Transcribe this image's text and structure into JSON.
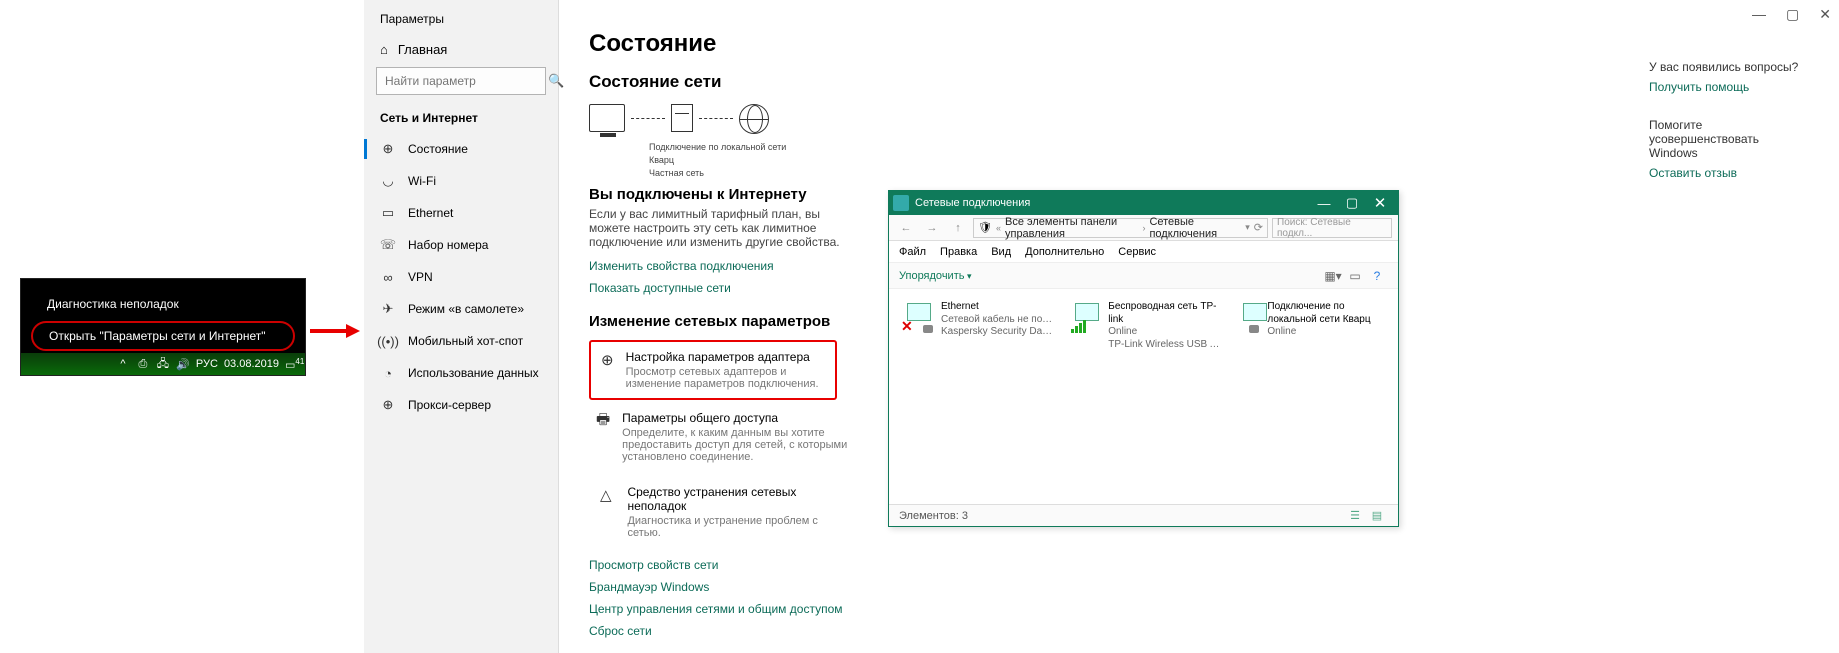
{
  "taskbar": {
    "item1": "Диагностика неполадок",
    "item2": "Открыть \"Параметры сети и Интернет\"",
    "lang": "РУС",
    "date": "03.08.2019",
    "badge": "41"
  },
  "settings": {
    "app_title": "Параметры",
    "home": "Главная",
    "search_placeholder": "Найти параметр",
    "section": "Сеть и Интернет",
    "nav": [
      {
        "label": "Состояние"
      },
      {
        "label": "Wi-Fi"
      },
      {
        "label": "Ethernet"
      },
      {
        "label": "Набор номера"
      },
      {
        "label": "VPN"
      },
      {
        "label": "Режим «в самолете»"
      },
      {
        "label": "Мобильный хот-спот"
      },
      {
        "label": "Использование данных"
      },
      {
        "label": "Прокси-сервер"
      }
    ],
    "page_title": "Состояние",
    "status_title": "Состояние сети",
    "diagram": {
      "line1": "Подключение по локальной сети",
      "line2": "Кварц",
      "line3": "Частная сеть"
    },
    "connected_title": "Вы подключены к Интернету",
    "connected_body": "Если у вас лимитный тарифный план, вы можете настроить эту сеть как лимитное подключение или изменить другие свойства.",
    "link_props": "Изменить свойства подключения",
    "link_show": "Показать доступные сети",
    "change_title": "Изменение сетевых параметров",
    "opts": [
      {
        "title": "Настройка параметров адаптера",
        "desc": "Просмотр сетевых адаптеров и изменение параметров подключения."
      },
      {
        "title": "Параметры общего доступа",
        "desc": "Определите, к каким данным вы хотите предоставить доступ для сетей, с которыми установлено соединение."
      },
      {
        "title": "Средство устранения сетевых неполадок",
        "desc": "Диагностика и устранение проблем с сетью."
      }
    ],
    "link_view_props": "Просмотр свойств сети",
    "link_firewall": "Брандмауэр Windows",
    "link_center": "Центр управления сетями и общим доступом",
    "link_reset": "Сброс сети",
    "help": {
      "q": "У вас появились вопросы?",
      "get": "Получить помощь",
      "improve": "Помогите усовершенствовать Windows",
      "feedback": "Оставить отзыв"
    }
  },
  "nc": {
    "title": "Сетевые подключения",
    "crumb1": "Все элементы панели управления",
    "crumb2": "Сетевые подключения",
    "search_ph": "Поиск: Сетевые подкл...",
    "menu": [
      "Файл",
      "Правка",
      "Вид",
      "Дополнительно",
      "Сервис"
    ],
    "organize": "Упорядочить",
    "adapters": [
      {
        "name": "Ethernet",
        "s1": "Сетевой кабель не подкл...",
        "s2": "Kaspersky Security Data Esc..."
      },
      {
        "name": "Беспроводная сеть TP-link",
        "s1": "Online",
        "s2": "TP-Link Wireless USB Adap..."
      },
      {
        "name": "Подключение по локальной сети Кварц",
        "s1": "Online",
        "s2": ""
      }
    ],
    "status": "Элементов: 3"
  }
}
